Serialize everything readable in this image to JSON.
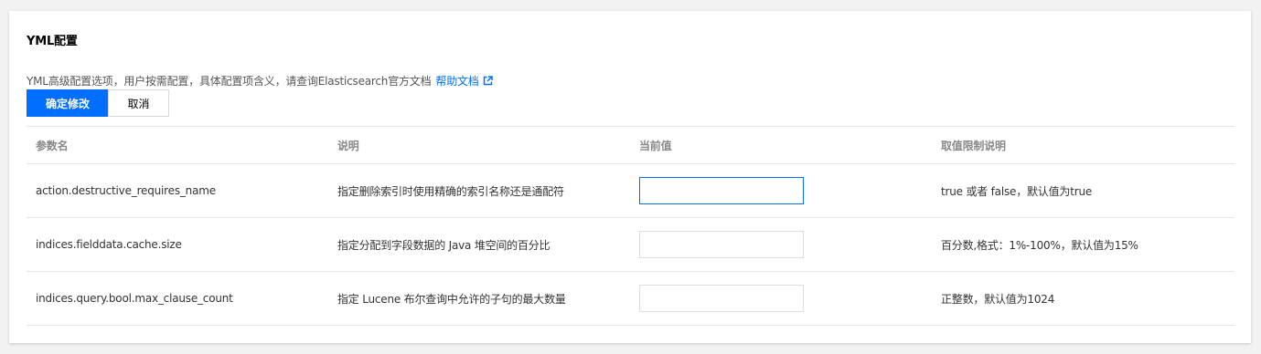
{
  "section": {
    "title": "YML配置",
    "description": "YML高级配置选项，用户按需配置，具体配置项含义，请查询Elasticsearch官方文档",
    "help_link": "帮助文档"
  },
  "actions": {
    "confirm_label": "确定修改",
    "cancel_label": "取消"
  },
  "table": {
    "headers": [
      "参数名",
      "说明",
      "当前值",
      "取值限制说明"
    ],
    "rows": [
      {
        "name": "action.destructive_requires_name",
        "desc": "指定删除索引时使用精确的索引名称还是通配符",
        "value": "",
        "limit": "true 或者 false，默认值为true"
      },
      {
        "name": "indices.fielddata.cache.size",
        "desc": "指定分配到字段数据的 Java 堆空间的百分比",
        "value": "",
        "limit": "百分数,格式：1%-100%，默认值为15%"
      },
      {
        "name": "indices.query.bool.max_clause_count",
        "desc": "指定 Lucene 布尔查询中允许的子句的最大数量",
        "value": "",
        "limit": "正整数，默认值为1024"
      }
    ]
  },
  "colors": {
    "accent": "#006eff",
    "background": "#f2f2f2",
    "border": "#e5e5e5"
  },
  "icons": {
    "help_link_icon": "external-link-icon"
  }
}
